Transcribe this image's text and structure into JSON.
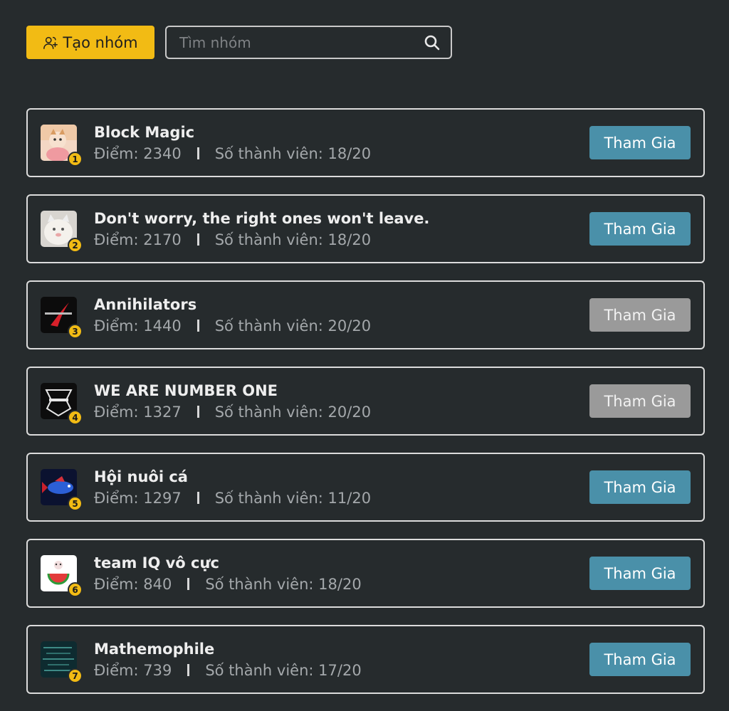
{
  "toolbar": {
    "create_label": "Tạo nhóm",
    "search_placeholder": "Tìm nhóm"
  },
  "score_label": "Điểm:",
  "members_label": "Số thành viên:",
  "groups": [
    {
      "rank": "1",
      "name": "Block Magic",
      "score": "2340",
      "members": "18/20",
      "button": "Tham Gia",
      "disabled": false
    },
    {
      "rank": "2",
      "name": "Don't worry, the right ones won't leave.",
      "score": "2170",
      "members": "18/20",
      "button": "Tham Gia",
      "disabled": false
    },
    {
      "rank": "3",
      "name": "Annihilators",
      "score": "1440",
      "members": "20/20",
      "button": "Tham Gia",
      "disabled": true
    },
    {
      "rank": "4",
      "name": "WE ARE NUMBER ONE",
      "score": "1327",
      "members": "20/20",
      "button": "Tham Gia",
      "disabled": true
    },
    {
      "rank": "5",
      "name": "Hội nuôi cá",
      "score": "1297",
      "members": "11/20",
      "button": "Tham Gia",
      "disabled": false
    },
    {
      "rank": "6",
      "name": "team IQ vô cực",
      "score": "840",
      "members": "18/20",
      "button": "Tham Gia",
      "disabled": false
    },
    {
      "rank": "7",
      "name": "Mathemophile",
      "score": "739",
      "members": "17/20",
      "button": "Tham Gia",
      "disabled": false
    }
  ],
  "colors": {
    "background": "#262b2d",
    "accent": "#f2bb14",
    "join": "#4a90a9",
    "join_disabled": "#9a9a9a"
  }
}
